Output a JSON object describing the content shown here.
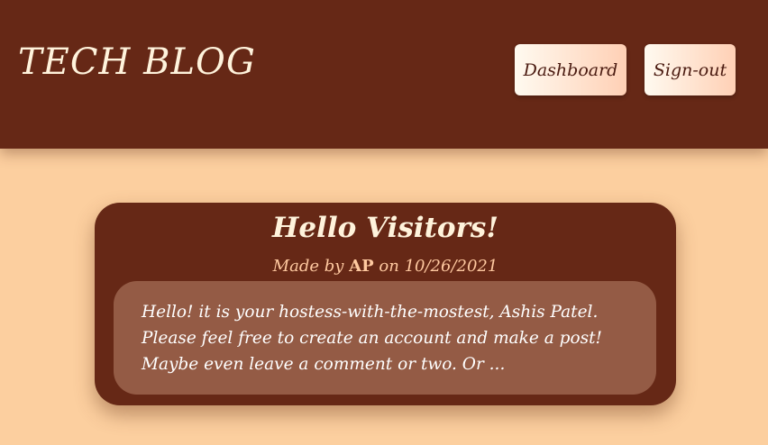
{
  "header": {
    "site_title": "TECH BLOG",
    "nav": {
      "dashboard_label": "Dashboard",
      "signout_label": "Sign-out"
    }
  },
  "post": {
    "title": "Hello Visitors!",
    "meta_prefix": "Made by",
    "author": "AP",
    "meta_on": "on",
    "date": "10/26/2021",
    "body_line_1": "Hello! it is your hostess-with-the-mostest, Ashis Patel.",
    "body_line_2": "Please feel free to create an account and make a post!",
    "body_line_3": "Maybe even leave a comment or two. Or ..."
  },
  "colors": {
    "page_background": "#fccf9f",
    "header_background": "#662816",
    "card_background": "#662816",
    "body_panel": "#945b45",
    "title_text": "#fff3dc",
    "meta_text": "#ffc9a0"
  }
}
